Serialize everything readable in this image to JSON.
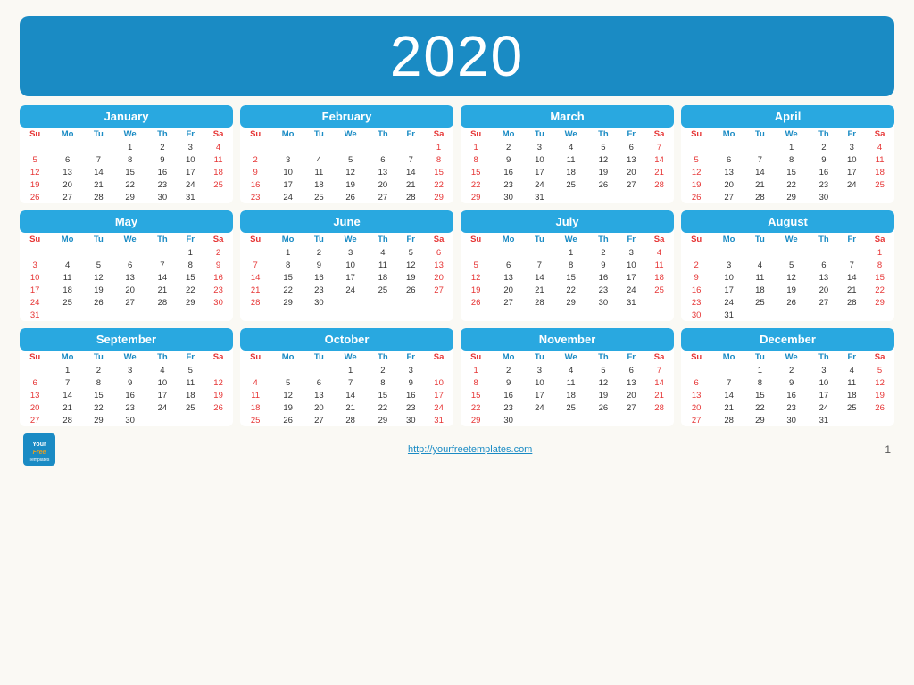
{
  "year": "2020",
  "months": [
    {
      "name": "January",
      "weeks": [
        [
          "",
          "",
          "",
          "1",
          "2",
          "3",
          "4"
        ],
        [
          "5",
          "6",
          "7",
          "8",
          "9",
          "10",
          "11"
        ],
        [
          "12",
          "13",
          "14",
          "15",
          "16",
          "17",
          "18"
        ],
        [
          "19",
          "20",
          "21",
          "22",
          "23",
          "24",
          "25"
        ],
        [
          "26",
          "27",
          "28",
          "29",
          "30",
          "31",
          ""
        ]
      ]
    },
    {
      "name": "February",
      "weeks": [
        [
          "",
          "",
          "",
          "",
          "",
          "",
          "1"
        ],
        [
          "2",
          "3",
          "4",
          "5",
          "6",
          "7",
          "8"
        ],
        [
          "9",
          "10",
          "11",
          "12",
          "13",
          "14",
          "15"
        ],
        [
          "16",
          "17",
          "18",
          "19",
          "20",
          "21",
          "22"
        ],
        [
          "23",
          "24",
          "25",
          "26",
          "27",
          "28",
          "29"
        ]
      ]
    },
    {
      "name": "March",
      "weeks": [
        [
          "1",
          "2",
          "3",
          "4",
          "5",
          "6",
          "7"
        ],
        [
          "8",
          "9",
          "10",
          "11",
          "12",
          "13",
          "14"
        ],
        [
          "15",
          "16",
          "17",
          "18",
          "19",
          "20",
          "21"
        ],
        [
          "22",
          "23",
          "24",
          "25",
          "26",
          "27",
          "28"
        ],
        [
          "29",
          "30",
          "31",
          "",
          "",
          "",
          ""
        ]
      ]
    },
    {
      "name": "April",
      "weeks": [
        [
          "",
          "",
          "",
          "1",
          "2",
          "3",
          "4"
        ],
        [
          "5",
          "6",
          "7",
          "8",
          "9",
          "10",
          "11"
        ],
        [
          "12",
          "13",
          "14",
          "15",
          "16",
          "17",
          "18"
        ],
        [
          "19",
          "20",
          "21",
          "22",
          "23",
          "24",
          "25"
        ],
        [
          "26",
          "27",
          "28",
          "29",
          "30",
          "",
          ""
        ]
      ]
    },
    {
      "name": "May",
      "weeks": [
        [
          "",
          "",
          "",
          "",
          "",
          "1",
          "2"
        ],
        [
          "3",
          "4",
          "5",
          "6",
          "7",
          "8",
          "9"
        ],
        [
          "10",
          "11",
          "12",
          "13",
          "14",
          "15",
          "16"
        ],
        [
          "17",
          "18",
          "19",
          "20",
          "21",
          "22",
          "23"
        ],
        [
          "24",
          "25",
          "26",
          "27",
          "28",
          "29",
          "30"
        ],
        [
          "31",
          "",
          "",
          "",
          "",
          "",
          ""
        ]
      ]
    },
    {
      "name": "June",
      "weeks": [
        [
          "",
          "1",
          "2",
          "3",
          "4",
          "5",
          "6"
        ],
        [
          "7",
          "8",
          "9",
          "10",
          "11",
          "12",
          "13"
        ],
        [
          "14",
          "15",
          "16",
          "17",
          "18",
          "19",
          "20"
        ],
        [
          "21",
          "22",
          "23",
          "24",
          "25",
          "26",
          "27"
        ],
        [
          "28",
          "29",
          "30",
          "",
          "",
          "",
          ""
        ]
      ]
    },
    {
      "name": "July",
      "weeks": [
        [
          "",
          "",
          "",
          "1",
          "2",
          "3",
          "4"
        ],
        [
          "5",
          "6",
          "7",
          "8",
          "9",
          "10",
          "11"
        ],
        [
          "12",
          "13",
          "14",
          "15",
          "16",
          "17",
          "18"
        ],
        [
          "19",
          "20",
          "21",
          "22",
          "23",
          "24",
          "25"
        ],
        [
          "26",
          "27",
          "28",
          "29",
          "30",
          "31",
          ""
        ]
      ]
    },
    {
      "name": "August",
      "weeks": [
        [
          "",
          "",
          "",
          "",
          "",
          "",
          "1"
        ],
        [
          "2",
          "3",
          "4",
          "5",
          "6",
          "7",
          "8"
        ],
        [
          "9",
          "10",
          "11",
          "12",
          "13",
          "14",
          "15"
        ],
        [
          "16",
          "17",
          "18",
          "19",
          "20",
          "21",
          "22"
        ],
        [
          "23",
          "24",
          "25",
          "26",
          "27",
          "28",
          "29"
        ],
        [
          "30",
          "31",
          "",
          "",
          "",
          "",
          ""
        ]
      ]
    },
    {
      "name": "September",
      "weeks": [
        [
          "",
          "1",
          "2",
          "3",
          "4",
          "5",
          ""
        ],
        [
          "6",
          "7",
          "8",
          "9",
          "10",
          "11",
          "12"
        ],
        [
          "13",
          "14",
          "15",
          "16",
          "17",
          "18",
          "19"
        ],
        [
          "20",
          "21",
          "22",
          "23",
          "24",
          "25",
          "26"
        ],
        [
          "27",
          "28",
          "29",
          "30",
          "",
          "",
          ""
        ]
      ]
    },
    {
      "name": "October",
      "weeks": [
        [
          "",
          "",
          "",
          "1",
          "2",
          "3",
          ""
        ],
        [
          "4",
          "5",
          "6",
          "7",
          "8",
          "9",
          "10"
        ],
        [
          "11",
          "12",
          "13",
          "14",
          "15",
          "16",
          "17"
        ],
        [
          "18",
          "19",
          "20",
          "21",
          "22",
          "23",
          "24"
        ],
        [
          "25",
          "26",
          "27",
          "28",
          "29",
          "30",
          "31"
        ]
      ]
    },
    {
      "name": "November",
      "weeks": [
        [
          "1",
          "2",
          "3",
          "4",
          "5",
          "6",
          "7"
        ],
        [
          "8",
          "9",
          "10",
          "11",
          "12",
          "13",
          "14"
        ],
        [
          "15",
          "16",
          "17",
          "18",
          "19",
          "20",
          "21"
        ],
        [
          "22",
          "23",
          "24",
          "25",
          "26",
          "27",
          "28"
        ],
        [
          "29",
          "30",
          "",
          "",
          "",
          "",
          ""
        ]
      ]
    },
    {
      "name": "December",
      "weeks": [
        [
          "",
          "",
          "1",
          "2",
          "3",
          "4",
          "5"
        ],
        [
          "6",
          "7",
          "8",
          "9",
          "10",
          "11",
          "12"
        ],
        [
          "13",
          "14",
          "15",
          "16",
          "17",
          "18",
          "19"
        ],
        [
          "20",
          "21",
          "22",
          "23",
          "24",
          "25",
          "26"
        ],
        [
          "27",
          "28",
          "29",
          "30",
          "31",
          "",
          ""
        ]
      ]
    }
  ],
  "dow": [
    "Su",
    "Mo",
    "Tu",
    "We",
    "Th",
    "Fr",
    "Sa"
  ],
  "footer": {
    "url": "http://yourfreetemplates.com",
    "page": "1",
    "logo_your": "Your",
    "logo_free": "Free",
    "logo_templates": "Templates"
  }
}
